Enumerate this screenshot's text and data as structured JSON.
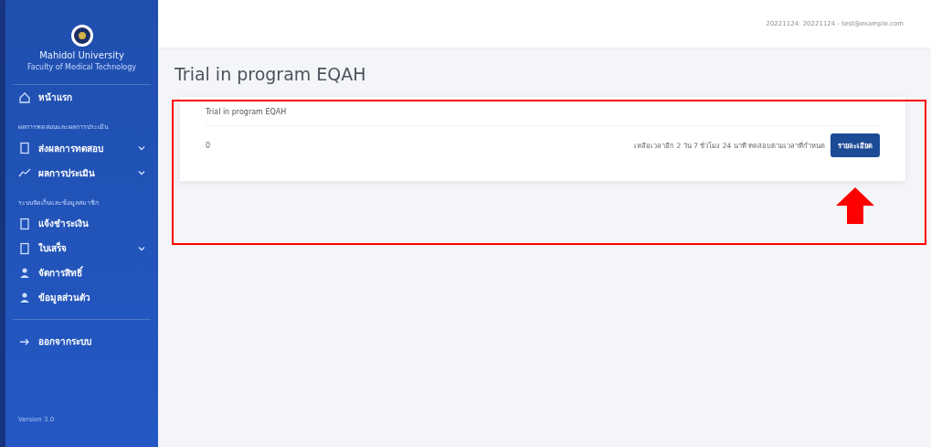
{
  "sidebar": {
    "brand": {
      "title": "Mahidol University",
      "subtitle": "Faculty of Medical Technology"
    },
    "items": [
      {
        "kind": "link",
        "label": "หน้าแรก",
        "expandable": false
      },
      {
        "kind": "heading",
        "label": "ผลการทดสอบและผลการประเมิน"
      },
      {
        "kind": "link",
        "label": "ส่งผลการทดสอบ",
        "expandable": true
      },
      {
        "kind": "link",
        "label": "ผลการประเมิน",
        "expandable": true
      },
      {
        "kind": "heading",
        "label": "ระบบจัดเก็บและข้อมูลสมาชิก"
      },
      {
        "kind": "link",
        "label": "แจ้งชำระเงิน",
        "expandable": false
      },
      {
        "kind": "link",
        "label": "ใบเสร็จ",
        "expandable": true
      },
      {
        "kind": "link",
        "label": "จัดการสิทธิ์",
        "expandable": false
      },
      {
        "kind": "link",
        "label": "ข้อมูลส่วนตัว",
        "expandable": false
      },
      {
        "kind": "divider"
      },
      {
        "kind": "link",
        "label": "ออกจากระบบ",
        "expandable": false
      }
    ],
    "version": "Version 3.0"
  },
  "topbar": {
    "user": "20221124: 20221124 - test@example.com"
  },
  "page_title": "Trial in program EQAH",
  "card": {
    "title": "Trial in program EQAH",
    "rows": [
      {
        "number": "0",
        "note": "เหลือเวลาอีก 2 วัน 7 ชั่วโมง 24 นาที ทดสอบตามเวลาที่กำหนด",
        "button": "รายละเอียด"
      }
    ]
  }
}
